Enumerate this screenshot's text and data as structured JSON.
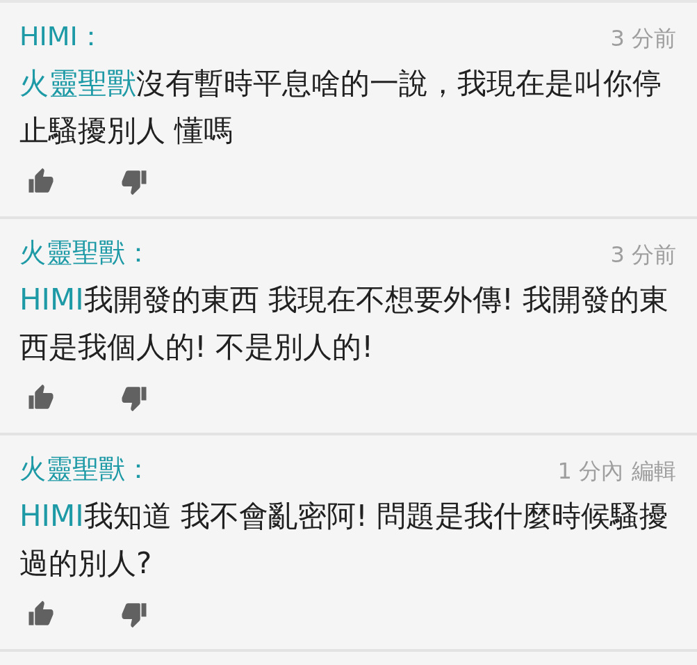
{
  "comments": [
    {
      "author": "HIMI：",
      "time": "3 分前",
      "mention": "火靈聖獸",
      "text": "沒有暫時平息啥的一說，我現在是叫你停止騷擾別人 懂嗎"
    },
    {
      "author": "火靈聖獸：",
      "time": "3 分前",
      "mention": "HIMI",
      "text": "我開發的東西 我現在不想要外傳! 我開發的東西是我個人的! 不是別人的!"
    },
    {
      "author": "火靈聖獸：",
      "time": "1 分內",
      "edit": "編輯",
      "mention": "HIMI",
      "text": "我知道 我不會亂密阿! 問題是我什麼時候騷擾過的別人?"
    }
  ]
}
